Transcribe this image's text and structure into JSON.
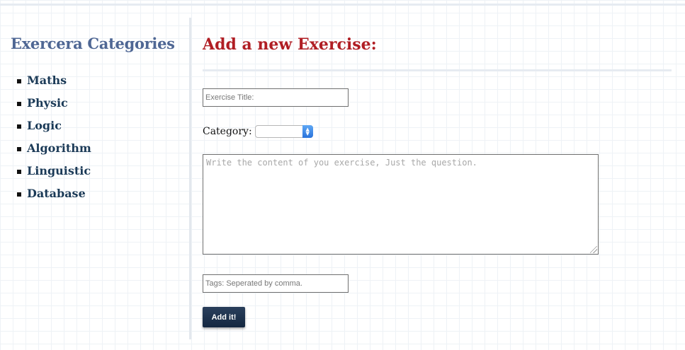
{
  "sidebar": {
    "title": "Exercera Categories",
    "items": [
      {
        "label": "Maths"
      },
      {
        "label": "Physic"
      },
      {
        "label": "Logic"
      },
      {
        "label": "Algorithm"
      },
      {
        "label": "Linguistic"
      },
      {
        "label": "Database"
      }
    ]
  },
  "form": {
    "title": "Add a new Exercise:",
    "exercise_title": {
      "value": "",
      "placeholder": "Exercise Title:"
    },
    "category": {
      "label": "Category:",
      "selected": ""
    },
    "content": {
      "value": "",
      "placeholder": "Write the content of you exercise, Just the question."
    },
    "tags": {
      "value": "",
      "placeholder": "Tags: Seperated by comma."
    },
    "submit_label": "Add it!"
  },
  "colors": {
    "sidebar_title": "#4f6794",
    "form_title": "#b01e24",
    "category_link": "#1b3a57",
    "button_bg": "#1a2d47",
    "select_arrow": "#2a73db"
  },
  "icons": {
    "select_arrow": "up-down-chevron-icon",
    "bullet": "square-bullet-icon"
  }
}
